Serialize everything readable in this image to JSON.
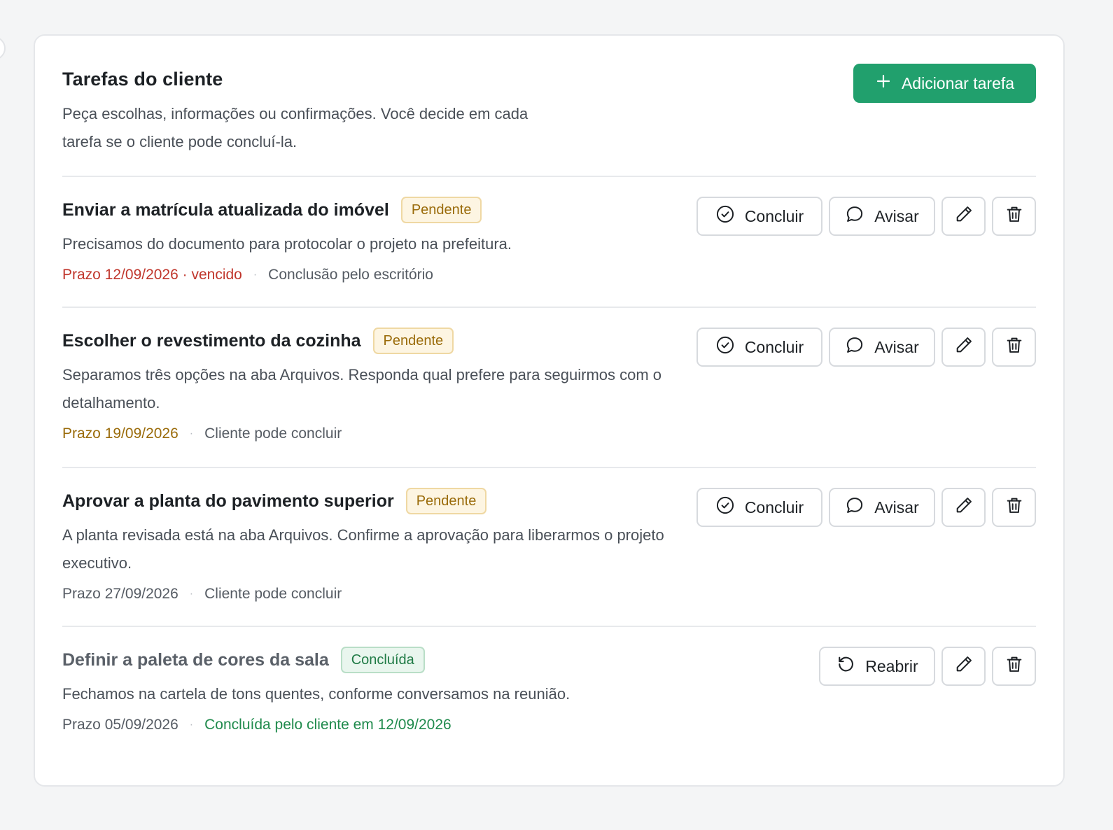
{
  "header": {
    "title": "Tarefas do cliente",
    "description": "Peça escolhas, informações ou confirmações. Você decide em cada tarefa se o cliente pode concluí-la.",
    "add_button_label": "Adicionar tarefa"
  },
  "actions": {
    "concluir": "Concluir",
    "avisar": "Avisar",
    "reabrir": "Reabrir"
  },
  "icons": {
    "add": "plus-icon",
    "concluir": "check-circle-icon",
    "avisar": "message-bubble-icon",
    "edit": "pencil-icon",
    "delete": "trash-icon",
    "reopen": "rotate-ccw-icon"
  },
  "colors": {
    "accent": "#21a06d",
    "overdue": "#c0362c",
    "pending": "#9a6b0a",
    "done": "#1f8a4c"
  },
  "tasks": [
    {
      "title": "Enviar a matrícula atualizada do imóvel",
      "status": "Pendente",
      "description": "Precisamos do documento para protocolar o projeto na prefeitura.",
      "due": "Prazo 12/09/2026 · vencido",
      "completion": "Conclusão pelo escritório"
    },
    {
      "title": "Escolher o revestimento da cozinha",
      "status": "Pendente",
      "description": "Separamos três opções na aba Arquivos. Responda qual prefere para seguirmos com o detalhamento.",
      "due": "Prazo 19/09/2026",
      "completion": "Cliente pode concluir"
    },
    {
      "title": "Aprovar a planta do pavimento superior",
      "status": "Pendente",
      "description": "A planta revisada está na aba Arquivos. Confirme a aprovação para liberarmos o projeto executivo.",
      "due": "Prazo 27/09/2026",
      "completion": "Cliente pode concluir"
    },
    {
      "title": "Definir a paleta de cores da sala",
      "status": "Concluída",
      "description": "Fechamos na cartela de tons quentes, conforme conversamos na reunião.",
      "due": "Prazo 05/09/2026",
      "completion": "Concluída pelo cliente em 12/09/2026"
    }
  ]
}
